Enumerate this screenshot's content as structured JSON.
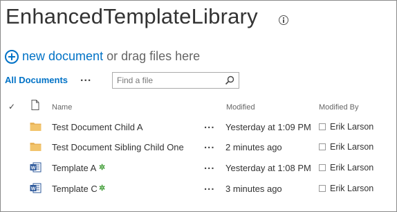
{
  "library": {
    "title": "EnhancedTemplateLibrary"
  },
  "toolbar": {
    "new_link": "new document",
    "new_rest": "or drag files here"
  },
  "view": {
    "tab_label": "All Documents",
    "more_label": "..."
  },
  "search": {
    "placeholder": "Find a file"
  },
  "columns": {
    "check": "✓",
    "name": "Name",
    "modified": "Modified",
    "modified_by": "Modified By"
  },
  "rows": [
    {
      "icon": "folder-icon",
      "name": "Test Document Child A",
      "new": "",
      "more": "...",
      "modified": "Yesterday at 1:09 PM",
      "modified_by": "Erik Larson"
    },
    {
      "icon": "folder-icon",
      "name": "Test Document Sibling Child One",
      "new": "",
      "more": "...",
      "modified": "2 minutes ago",
      "modified_by": "Erik Larson"
    },
    {
      "icon": "word-doc-icon",
      "name": "Template A",
      "new": "✲",
      "more": "...",
      "modified": "Yesterday at 1:08 PM",
      "modified_by": "Erik Larson"
    },
    {
      "icon": "word-doc-icon",
      "name": "Template C",
      "new": "✲",
      "more": "...",
      "modified": "3 minutes ago",
      "modified_by": "Erik Larson"
    }
  ],
  "colors": {
    "accent": "#0072c6",
    "folder": "#e8b35a",
    "word": "#2b579a",
    "new_badge": "#3f9c35"
  }
}
